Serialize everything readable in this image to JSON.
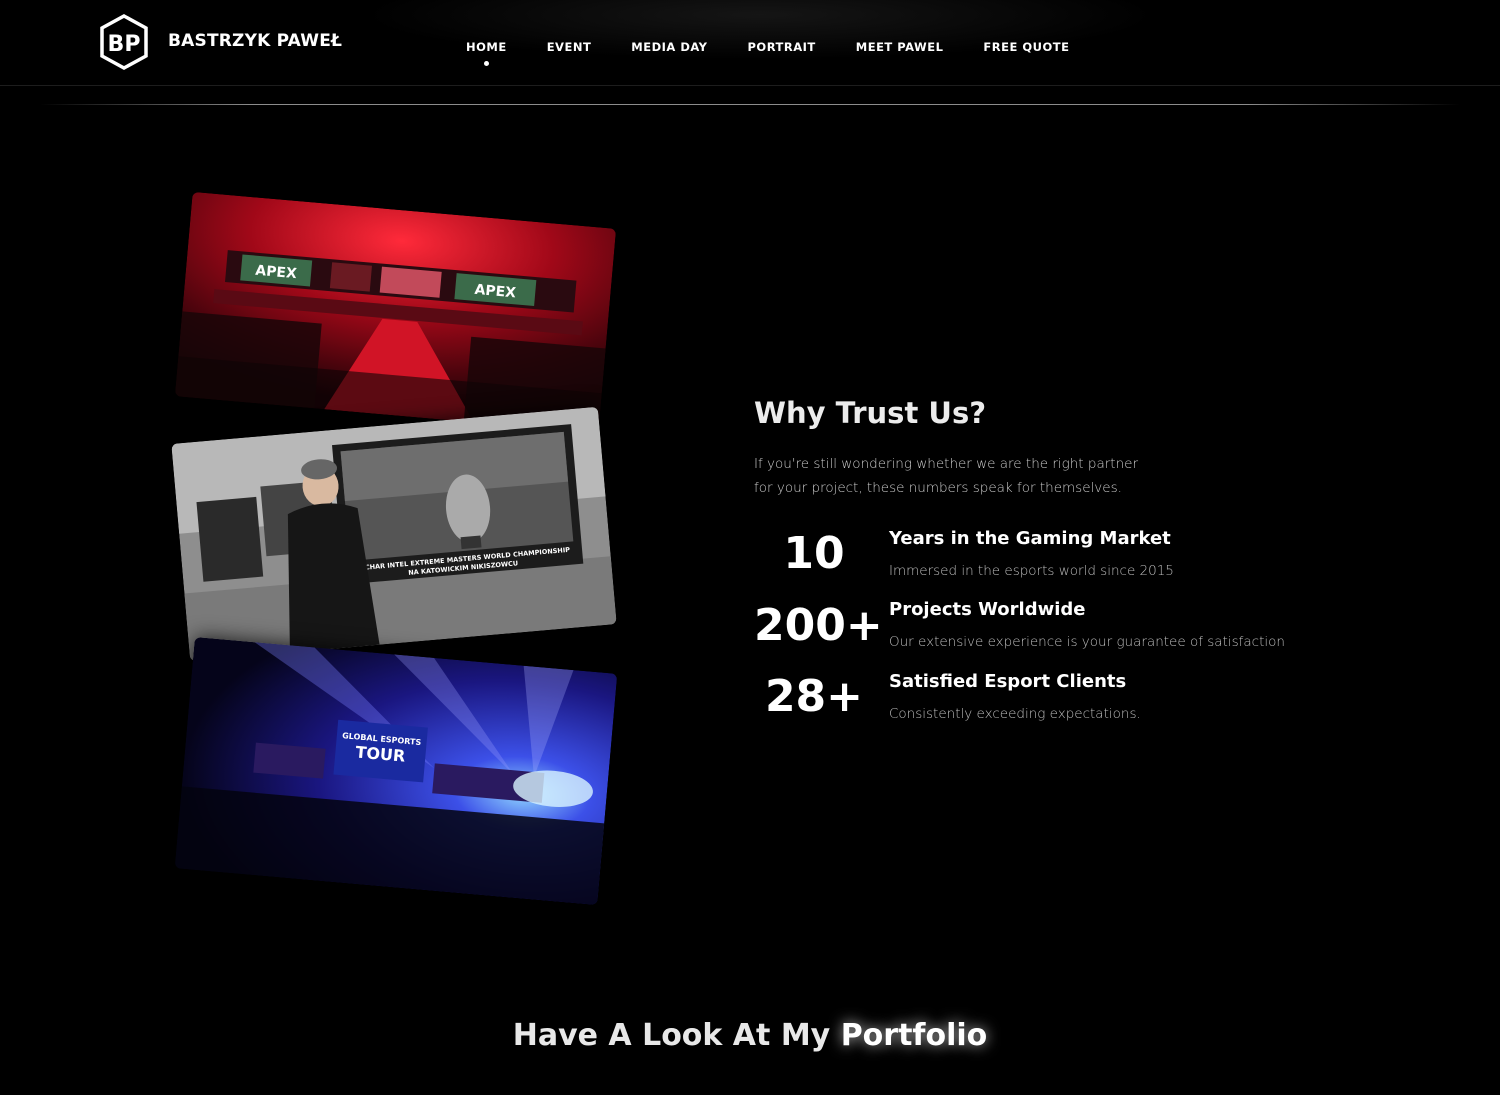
{
  "header": {
    "brand": "BASTRZYK PAWEŁ",
    "logo_letters": "BP",
    "nav": [
      {
        "label": "HOME",
        "active": true
      },
      {
        "label": "EVENT"
      },
      {
        "label": "MEDIA DAY"
      },
      {
        "label": "PORTRAIT"
      },
      {
        "label": "MEET PAWEL"
      },
      {
        "label": "FREE QUOTE"
      }
    ]
  },
  "trust": {
    "title": "Why Trust Us?",
    "description_line1": "If you're still wondering whether we are the right partner",
    "description_line2": "for your project, these numbers speak for themselves.",
    "stats": [
      {
        "number": "10",
        "title": "Years in the Gaming Market",
        "subtitle": "Immersed in the esports world since 2015"
      },
      {
        "number": "200+",
        "title": "Projects Worldwide",
        "subtitle": "Our extensive experience is your guarantee of satisfaction"
      },
      {
        "number": "28+",
        "title": "Satisfied Esport Clients",
        "subtitle": "Consistently exceeding expectations."
      }
    ]
  },
  "photos": {
    "photo1_banner_text": "APEX",
    "photo2_sign_line1": "PUCHAR INTEL EXTREME MASTERS WORLD CHAMPIONSHIP",
    "photo2_sign_line2": "NA KATOWICKIM NIKISZOWCU",
    "photo3_screen_line1": "GLOBAL ESPORTS",
    "photo3_screen_line2": "TOUR"
  },
  "portfolio": {
    "title_prefix": "Have A Look At My",
    "title_accent": "Portfolio"
  }
}
